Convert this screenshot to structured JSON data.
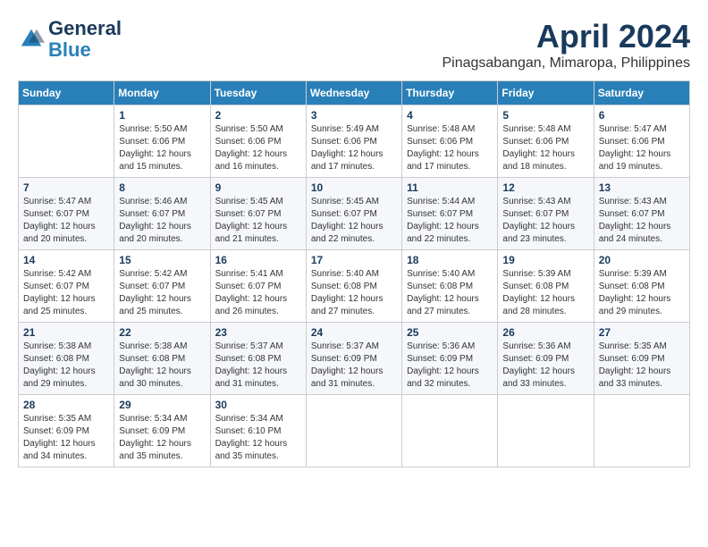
{
  "header": {
    "logo_line1": "General",
    "logo_line2": "Blue",
    "month_title": "April 2024",
    "location": "Pinagsabangan, Mimaropa, Philippines"
  },
  "weekdays": [
    "Sunday",
    "Monday",
    "Tuesday",
    "Wednesday",
    "Thursday",
    "Friday",
    "Saturday"
  ],
  "weeks": [
    [
      {
        "day": "",
        "info": ""
      },
      {
        "day": "1",
        "info": "Sunrise: 5:50 AM\nSunset: 6:06 PM\nDaylight: 12 hours\nand 15 minutes."
      },
      {
        "day": "2",
        "info": "Sunrise: 5:50 AM\nSunset: 6:06 PM\nDaylight: 12 hours\nand 16 minutes."
      },
      {
        "day": "3",
        "info": "Sunrise: 5:49 AM\nSunset: 6:06 PM\nDaylight: 12 hours\nand 17 minutes."
      },
      {
        "day": "4",
        "info": "Sunrise: 5:48 AM\nSunset: 6:06 PM\nDaylight: 12 hours\nand 17 minutes."
      },
      {
        "day": "5",
        "info": "Sunrise: 5:48 AM\nSunset: 6:06 PM\nDaylight: 12 hours\nand 18 minutes."
      },
      {
        "day": "6",
        "info": "Sunrise: 5:47 AM\nSunset: 6:06 PM\nDaylight: 12 hours\nand 19 minutes."
      }
    ],
    [
      {
        "day": "7",
        "info": "Sunrise: 5:47 AM\nSunset: 6:07 PM\nDaylight: 12 hours\nand 20 minutes."
      },
      {
        "day": "8",
        "info": "Sunrise: 5:46 AM\nSunset: 6:07 PM\nDaylight: 12 hours\nand 20 minutes."
      },
      {
        "day": "9",
        "info": "Sunrise: 5:45 AM\nSunset: 6:07 PM\nDaylight: 12 hours\nand 21 minutes."
      },
      {
        "day": "10",
        "info": "Sunrise: 5:45 AM\nSunset: 6:07 PM\nDaylight: 12 hours\nand 22 minutes."
      },
      {
        "day": "11",
        "info": "Sunrise: 5:44 AM\nSunset: 6:07 PM\nDaylight: 12 hours\nand 22 minutes."
      },
      {
        "day": "12",
        "info": "Sunrise: 5:43 AM\nSunset: 6:07 PM\nDaylight: 12 hours\nand 23 minutes."
      },
      {
        "day": "13",
        "info": "Sunrise: 5:43 AM\nSunset: 6:07 PM\nDaylight: 12 hours\nand 24 minutes."
      }
    ],
    [
      {
        "day": "14",
        "info": "Sunrise: 5:42 AM\nSunset: 6:07 PM\nDaylight: 12 hours\nand 25 minutes."
      },
      {
        "day": "15",
        "info": "Sunrise: 5:42 AM\nSunset: 6:07 PM\nDaylight: 12 hours\nand 25 minutes."
      },
      {
        "day": "16",
        "info": "Sunrise: 5:41 AM\nSunset: 6:07 PM\nDaylight: 12 hours\nand 26 minutes."
      },
      {
        "day": "17",
        "info": "Sunrise: 5:40 AM\nSunset: 6:08 PM\nDaylight: 12 hours\nand 27 minutes."
      },
      {
        "day": "18",
        "info": "Sunrise: 5:40 AM\nSunset: 6:08 PM\nDaylight: 12 hours\nand 27 minutes."
      },
      {
        "day": "19",
        "info": "Sunrise: 5:39 AM\nSunset: 6:08 PM\nDaylight: 12 hours\nand 28 minutes."
      },
      {
        "day": "20",
        "info": "Sunrise: 5:39 AM\nSunset: 6:08 PM\nDaylight: 12 hours\nand 29 minutes."
      }
    ],
    [
      {
        "day": "21",
        "info": "Sunrise: 5:38 AM\nSunset: 6:08 PM\nDaylight: 12 hours\nand 29 minutes."
      },
      {
        "day": "22",
        "info": "Sunrise: 5:38 AM\nSunset: 6:08 PM\nDaylight: 12 hours\nand 30 minutes."
      },
      {
        "day": "23",
        "info": "Sunrise: 5:37 AM\nSunset: 6:08 PM\nDaylight: 12 hours\nand 31 minutes."
      },
      {
        "day": "24",
        "info": "Sunrise: 5:37 AM\nSunset: 6:09 PM\nDaylight: 12 hours\nand 31 minutes."
      },
      {
        "day": "25",
        "info": "Sunrise: 5:36 AM\nSunset: 6:09 PM\nDaylight: 12 hours\nand 32 minutes."
      },
      {
        "day": "26",
        "info": "Sunrise: 5:36 AM\nSunset: 6:09 PM\nDaylight: 12 hours\nand 33 minutes."
      },
      {
        "day": "27",
        "info": "Sunrise: 5:35 AM\nSunset: 6:09 PM\nDaylight: 12 hours\nand 33 minutes."
      }
    ],
    [
      {
        "day": "28",
        "info": "Sunrise: 5:35 AM\nSunset: 6:09 PM\nDaylight: 12 hours\nand 34 minutes."
      },
      {
        "day": "29",
        "info": "Sunrise: 5:34 AM\nSunset: 6:09 PM\nDaylight: 12 hours\nand 35 minutes."
      },
      {
        "day": "30",
        "info": "Sunrise: 5:34 AM\nSunset: 6:10 PM\nDaylight: 12 hours\nand 35 minutes."
      },
      {
        "day": "",
        "info": ""
      },
      {
        "day": "",
        "info": ""
      },
      {
        "day": "",
        "info": ""
      },
      {
        "day": "",
        "info": ""
      }
    ]
  ]
}
